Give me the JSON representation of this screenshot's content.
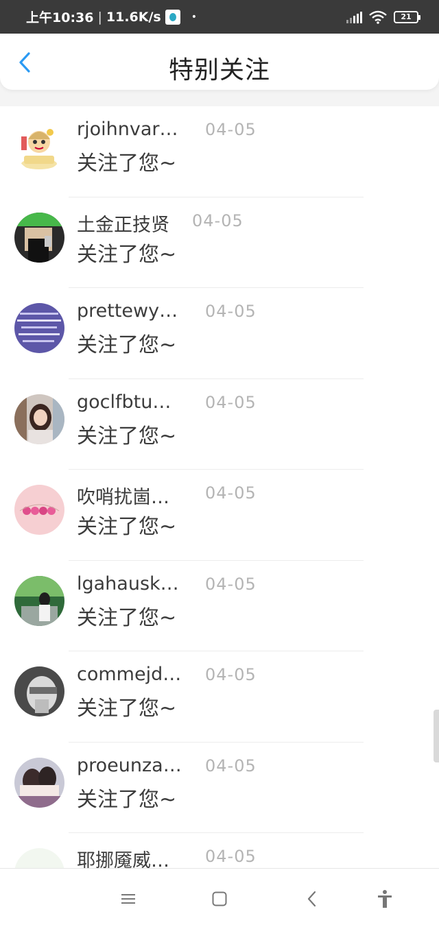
{
  "status_bar": {
    "time": "上午10:36",
    "separator": "|",
    "speed": "11.6K/s",
    "dot": "•",
    "battery": "21"
  },
  "header": {
    "title": "特别关注",
    "accent_color": "#2b9af3"
  },
  "items": [
    {
      "name": "rjoihnvar…",
      "date": "04-05",
      "message": "关注了您~",
      "avatar": "cartoon-monkey-avatar"
    },
    {
      "name": "土金正技贤",
      "date": "04-05",
      "message": "关注了您~",
      "avatar": "photo-avatar-green"
    },
    {
      "name": "prettewy…",
      "date": "04-05",
      "message": "关注了您~",
      "avatar": "text-collage-avatar"
    },
    {
      "name": "goclfbtu…",
      "date": "04-05",
      "message": "关注了您~",
      "avatar": "girl-photo-avatar"
    },
    {
      "name": "吹哨扰崮…",
      "date": "04-05",
      "message": "关注了您~",
      "avatar": "pink-flowers-avatar"
    },
    {
      "name": "lgahausk…",
      "date": "04-05",
      "message": "关注了您~",
      "avatar": "outdoor-couple-avatar"
    },
    {
      "name": "commejd…",
      "date": "04-05",
      "message": "关注了您~",
      "avatar": "bw-face-avatar"
    },
    {
      "name": "proeunza…",
      "date": "04-05",
      "message": "关注了您~",
      "avatar": "couple-photo-avatar"
    },
    {
      "name": "耶挪魇威…",
      "date": "04-05",
      "message": "",
      "avatar": "calligraphy-avatar"
    }
  ],
  "nav": {
    "buttons": [
      "menu",
      "home",
      "back",
      "accessibility"
    ]
  }
}
